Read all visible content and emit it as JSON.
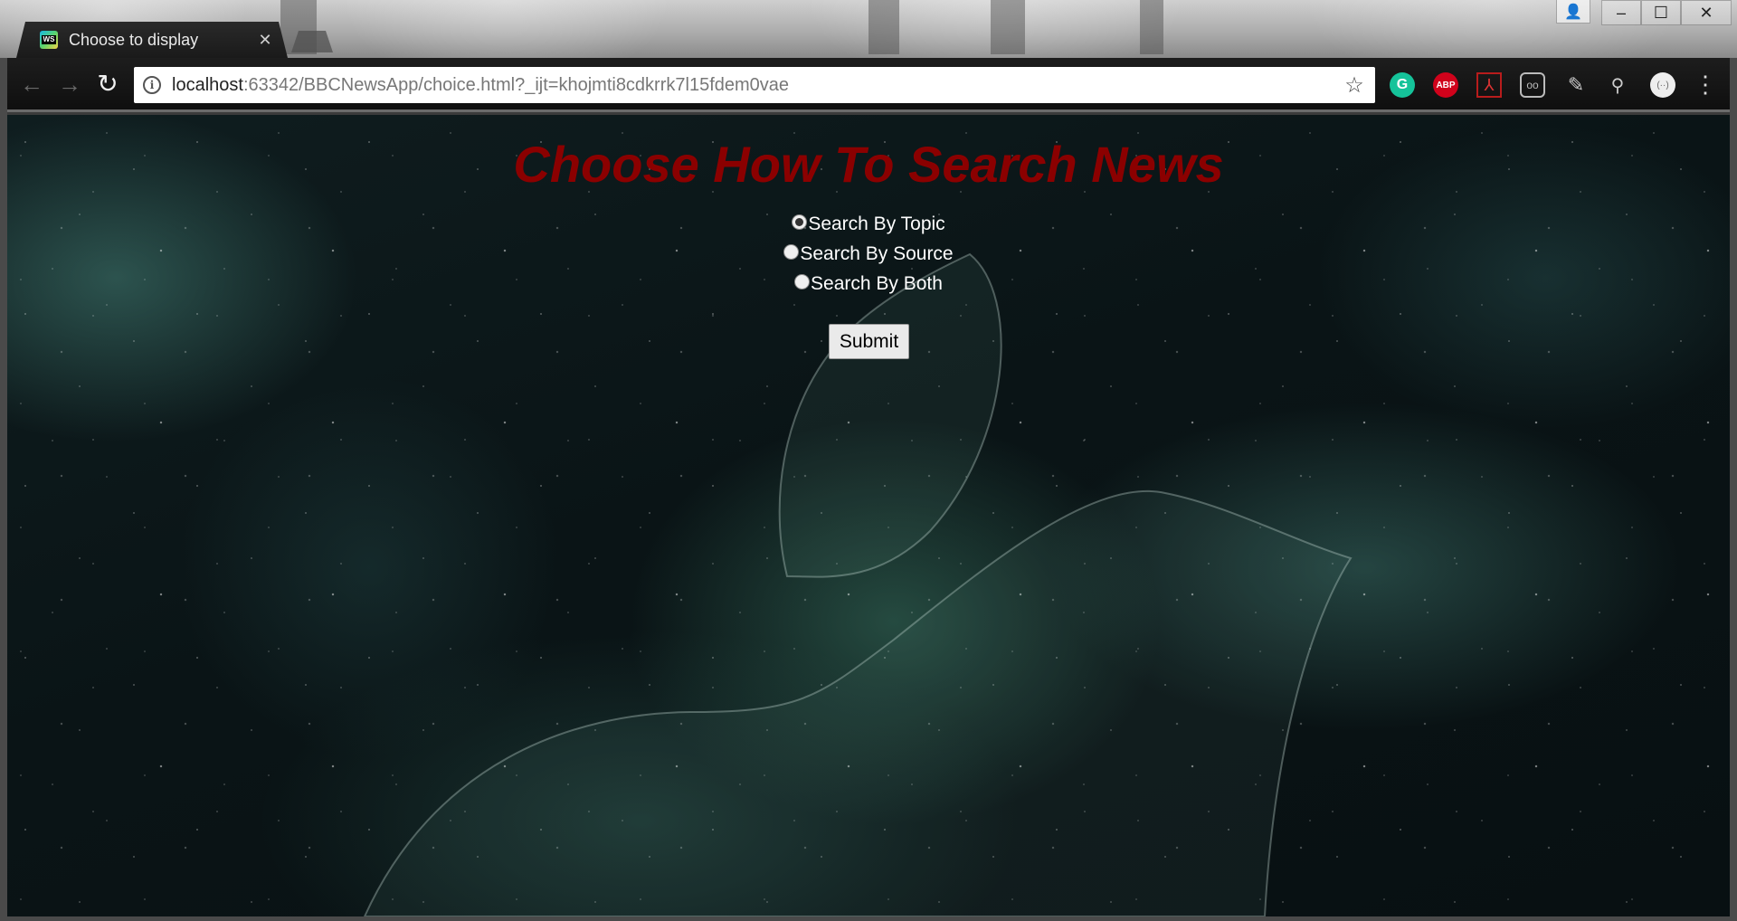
{
  "browser": {
    "tab_title": "Choose to display",
    "tab_favicon_text": "WS",
    "tab_close": "×",
    "url_host": "localhost",
    "url_rest": ":63342/BBCNewsApp/choice.html?_ijt=khojmti8cdkrrk7l15fdem0vae",
    "icons": {
      "back": "←",
      "forward": "→",
      "reload": "↻",
      "info": "i",
      "star": "☆",
      "grammarly": "G",
      "abp": "ABP",
      "pdf": "⅄",
      "glasses": "oo",
      "pen": "✎",
      "search": "⚲",
      "circle": "(··)",
      "menu": "⋮",
      "profile": "👤",
      "minimize": "–",
      "maximize": "☐",
      "close": "✕"
    }
  },
  "page": {
    "heading": "Choose How To Search News",
    "options": [
      {
        "label": "Search By Topic",
        "checked": true
      },
      {
        "label": "Search By Source",
        "checked": false
      },
      {
        "label": "Search By Both",
        "checked": false
      }
    ],
    "submit_label": "Submit"
  },
  "colors": {
    "heading": "#8b0000",
    "option_text": "#ffffff",
    "background": "#0a1416"
  }
}
